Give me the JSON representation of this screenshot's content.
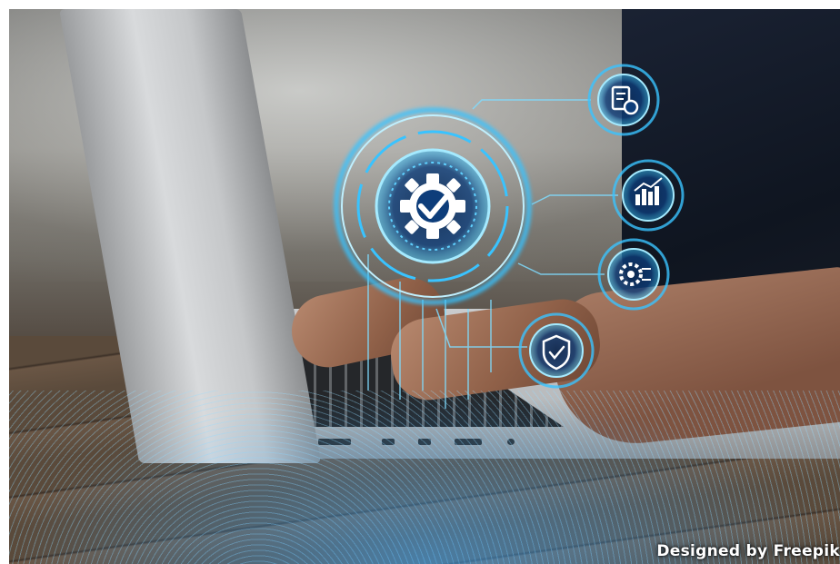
{
  "image": {
    "subject": "laptop-typing-with-holographic-icons",
    "watermark_text": "Designed by Freepik"
  },
  "holograms": {
    "main_icon": "gear-check-icon",
    "side_icons": [
      "document-gear-icon",
      "chart-icon",
      "chip-gear-icon",
      "shield-check-icon"
    ],
    "glow_color": "#39c3ff"
  }
}
